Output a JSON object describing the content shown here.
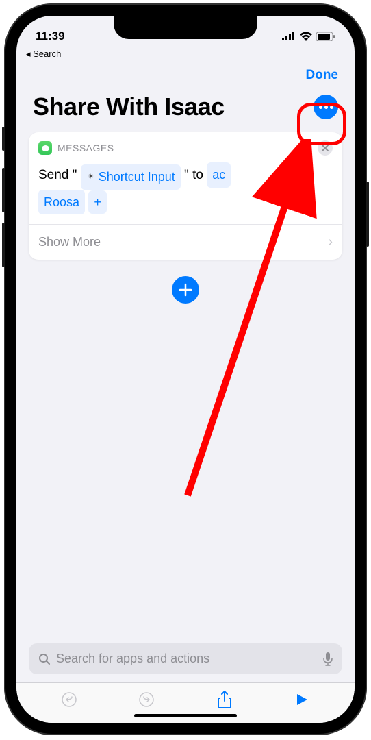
{
  "status": {
    "time": "11:39",
    "back_label": "◂ Search"
  },
  "nav": {
    "done": "Done"
  },
  "header": {
    "title": "Share With Isaac"
  },
  "action_card": {
    "app_label": "MESSAGES",
    "send_prefix": "Send \"",
    "input_token": "Shortcut Input",
    "send_mid": "\" to",
    "recipient_1": "ac",
    "recipient_2": "Roosa",
    "add_symbol": "+",
    "show_more": "Show More"
  },
  "search": {
    "placeholder": "Search for apps and actions"
  }
}
